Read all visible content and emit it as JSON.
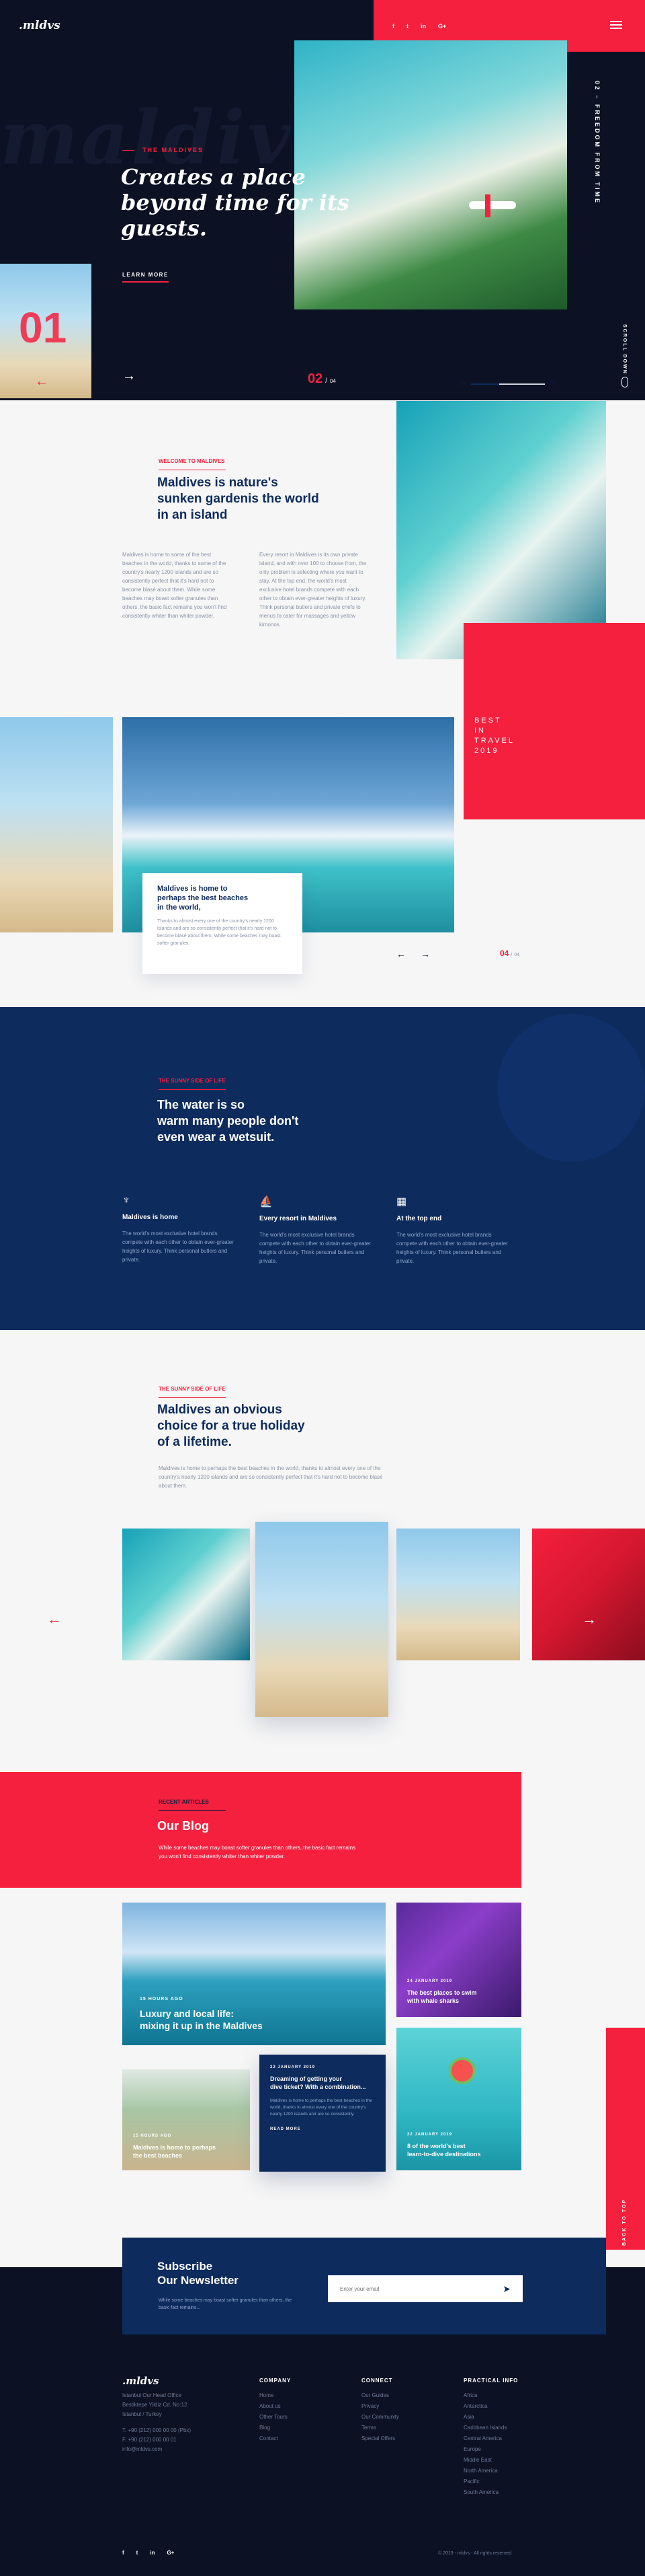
{
  "brand": {
    "logo": ".mldvs"
  },
  "colors": {
    "accent": "#f5203e",
    "navy": "#0d2b5c",
    "dark": "#0c1223"
  },
  "social": [
    "f",
    "t",
    "in",
    "G+"
  ],
  "hero": {
    "eyebrow": "THE MALDIVES",
    "headline_1": "Creates a place",
    "headline_2": "beyond time for its",
    "headline_3": "guests.",
    "cta": "LEARN MORE",
    "watermark": "maldives",
    "side_caption": "02 – FREEDOM FROM TIME",
    "slide_index": "01",
    "slide_current": "02",
    "slide_total": "04",
    "progress_start": "00",
    "progress_end": "05",
    "progress": 0.38,
    "scroll_label": "SCROLL DOWN"
  },
  "welcome": {
    "eyebrow": "WELCOME TO MALDIVES",
    "title_1": "Maldives is nature's",
    "title_2": "sunken gardenis the world",
    "title_3": "in an island",
    "col1": "Maldives is home to some of the best beaches in the world, thanks to some of the country's nearly 1200 islands and are so consistently perfect that it's hard not to become blasé about them. While some beaches may boast softer granules than others, the basic fact remains you won't find consistently whiter than whiter powder.",
    "col2": "Every resort in Maldives is its own private island, and with over 100 to choose from, the only problem is selecting where you want to stay. At the top end, the world's most exclusive hotel brands compete with each other to obtain ever-greater heights of luxury. Think personal butlers and private chefs to menus to cater for massages and yellow kimonos."
  },
  "best": {
    "line1": "BEST",
    "line2": "IN",
    "line3": "TRAVEL",
    "line4": "2019"
  },
  "beach_card": {
    "title_1": "Maldives is home to",
    "title_2": "perhaps the best beaches",
    "title_3": "in the world,",
    "text": "Thanks to almost every one of the country's nearly 1200 islands and are so consistently perfect that it's hard not to become blasé about them. While some beaches may boast softer granules."
  },
  "beach_slider": {
    "current": "04",
    "total": "04"
  },
  "sunny": {
    "eyebrow": "THE SUNNY SIDE OF LIFE",
    "title_1": "The water is so",
    "title_2": "warm many people don't",
    "title_3": "even wear a wetsuit.",
    "features": [
      {
        "icon": "palm-tree-icon",
        "title": "Maldives is home",
        "text": "The world's most exclusive hotel brands compete with each other to obtain ever-greater heights of luxury. Think personal butlers and private."
      },
      {
        "icon": "sailboat-icon",
        "title": "Every resort in Maldives",
        "text": "The world's most exclusive hotel brands compete with each other to obtain ever-greater heights of luxury. Think personal butlers and private."
      },
      {
        "icon": "hotel-icon",
        "title": "At the top end",
        "text": "The world's most exclusive hotel brands compete with each other to obtain ever-greater heights of luxury. Think personal butlers and private."
      }
    ]
  },
  "holiday": {
    "eyebrow": "THE SUNNY SIDE OF LIFE",
    "title_1": "Maldives an obvious",
    "title_2": "choice for a true holiday",
    "title_3": "of a lifetime.",
    "text": "Maldives is home to perhaps the best beaches in the world, thanks to almost every one of the country's nearly 1200 islands and are so consistently perfect that it's hard not to become blasé about them."
  },
  "blog": {
    "eyebrow": "RECENT ARTICLES",
    "title": "Our Blog",
    "intro_1": "While some beaches may boast softer granules than others, the basic fact remains",
    "intro_2": "you won't find consistently whiter than whiter powder.",
    "posts": [
      {
        "date": "15 HOURS AGO",
        "title_1": "Luxury and local life:",
        "title_2": "mixing it up in the Maldives"
      },
      {
        "date": "24 JANUARY 2019",
        "title_1": "The best places to swim",
        "title_2": "with whale sharks"
      },
      {
        "date": "15 HOURS AGO",
        "title_1": "Maldives is home to perhaps",
        "title_2": "the best beaches"
      },
      {
        "date": "22 JANUARY 2019",
        "title_1": "Dreaming of getting your",
        "title_2": "dive ticket? With a combination...",
        "text": "Maldives is home to perhaps the best beaches in the world, thanks to almost every one of the country's nearly 1200 islands and are so consistently.",
        "cta": "READ MORE"
      },
      {
        "date": "22 JANUARY 2019",
        "title_1": "8 of the world's best",
        "title_2": "learn-to-dive destinations"
      }
    ]
  },
  "newsletter": {
    "title_1": "Subscribe",
    "title_2": "Our Newsletter",
    "text": "While some beaches may boast softer granules than others, the basic fact remains...",
    "placeholder": "Enter your email"
  },
  "back_to_top": "BACK TO TOP",
  "footer": {
    "logo": ".mldvs",
    "address": [
      "Istanbul Our Head Office",
      "Bestiktepe Yildiz Cd. No:12",
      "Istanbul / Turkey"
    ],
    "phone": "T. +90 (212) 000 00 00 (Pbx)",
    "fax": "F. +90 (212) 000 00 01",
    "email": "info@mldvs.com",
    "company": {
      "title": "COMPANY",
      "items": [
        "Home",
        "About us",
        "Other Tours",
        "Blog",
        "Contact"
      ]
    },
    "connect": {
      "title": "CONNECT",
      "items": [
        "Our Guides",
        "Privacy",
        "Our Community",
        "Terms",
        "Special Offers"
      ]
    },
    "practical": {
      "title": "PRACTICAL INFO",
      "items": [
        "Africa",
        "Antarctica",
        "Asia",
        "Caribbean Islands",
        "Central America",
        "Europe",
        "Middle East",
        "North America",
        "Pacific",
        "South America"
      ]
    },
    "copyright": "© 2019 - mldvs - All rights reserved."
  }
}
